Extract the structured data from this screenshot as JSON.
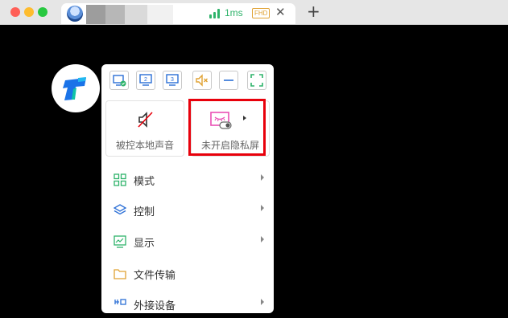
{
  "tab": {
    "latency": "1ms",
    "quality_badge": "FHD",
    "close_label": "✕",
    "new_tab_label": "+"
  },
  "toolbar": {
    "buttons": [
      {
        "name": "screen-select-icon"
      },
      {
        "name": "display-2-icon",
        "label": "2"
      },
      {
        "name": "display-3-icon",
        "label": "3"
      },
      {
        "name": "mute-icon"
      },
      {
        "name": "minimize-icon"
      },
      {
        "name": "fullscreen-icon"
      }
    ]
  },
  "cards": {
    "sound": {
      "label": "被控本地声音"
    },
    "privacy": {
      "label": "未开启隐私屏"
    }
  },
  "menu": {
    "items": [
      {
        "label": "模式",
        "icon": "grid-icon",
        "has_submenu": true
      },
      {
        "label": "控制",
        "icon": "layers-icon",
        "has_submenu": true
      },
      {
        "label": "显示",
        "icon": "monitor-chart-icon",
        "has_submenu": true
      },
      {
        "label": "文件传输",
        "icon": "folder-icon",
        "has_submenu": false
      },
      {
        "label": "外接设备",
        "icon": "device-icon",
        "has_submenu": true
      }
    ]
  },
  "colors": {
    "accent_blue": "#2b6fd6",
    "accent_green": "#2fb36b",
    "accent_orange": "#e0a233",
    "privacy_pink": "#e94fb4",
    "highlight_red": "#e8000b"
  }
}
